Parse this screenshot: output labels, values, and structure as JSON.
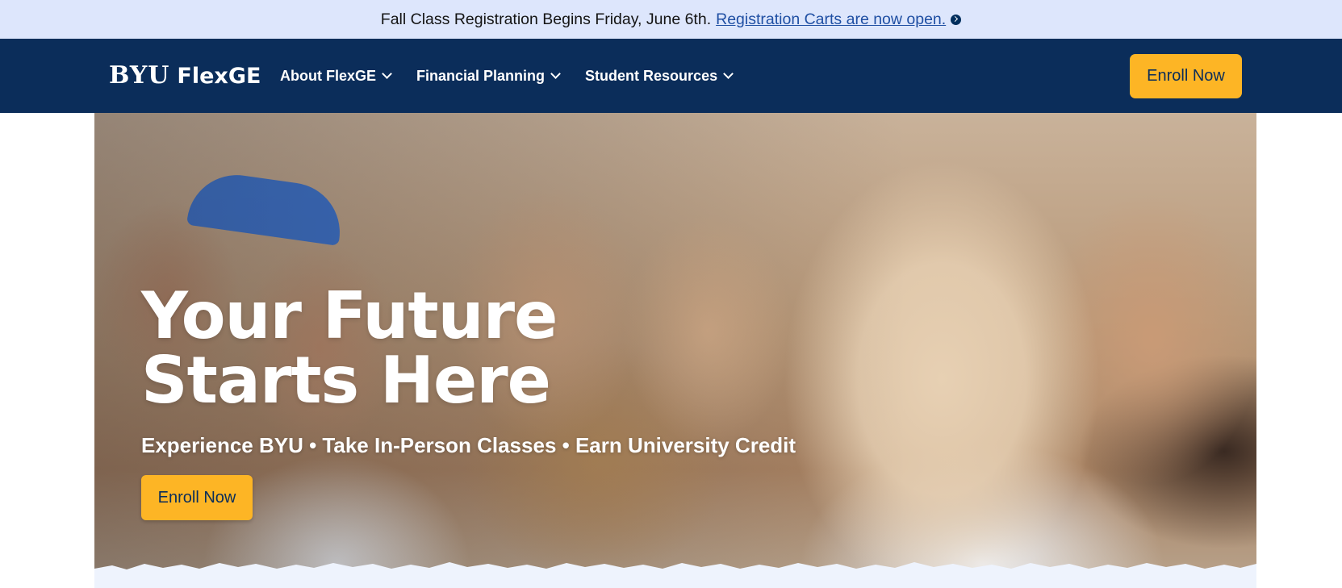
{
  "announcement": {
    "text": "Fall Class Registration Begins Friday, June 6th.",
    "link_label": "Registration Carts are now open.",
    "link_icon": "arrow-circle-right-icon"
  },
  "nav": {
    "logo_mark": "BYU",
    "logo_text": "FlexGE",
    "menu": [
      {
        "label": "About FlexGE",
        "icon": "chevron-down-icon"
      },
      {
        "label": "Financial Planning",
        "icon": "chevron-down-icon"
      },
      {
        "label": "Student Resources",
        "icon": "chevron-down-icon"
      }
    ],
    "cta_label": "Enroll Now"
  },
  "hero": {
    "title_line1": "Your Future",
    "title_line2": "Starts Here",
    "subtitle": "Experience BYU • Take In-Person Classes • Earn University Credit",
    "cta_label": "Enroll Now"
  },
  "colors": {
    "announcement_bg": "#dde6fc",
    "navy": "#0b2d5a",
    "gold": "#fdb525",
    "link_blue": "#1f4fa3"
  }
}
